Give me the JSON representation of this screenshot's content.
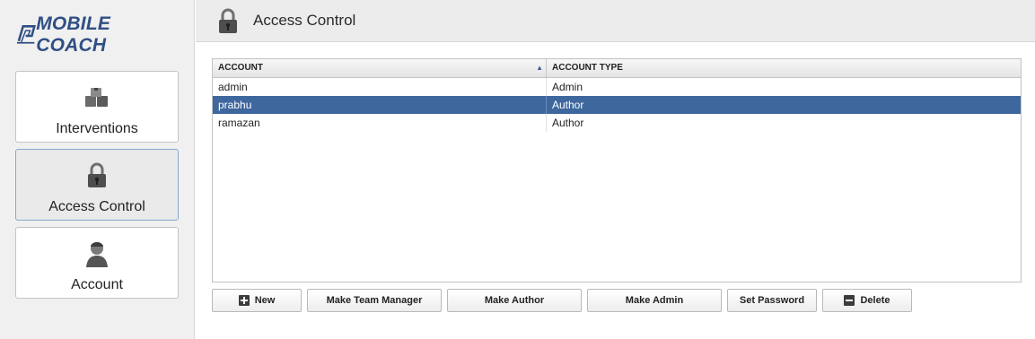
{
  "brand": {
    "logo_text": "MOBILE COACH"
  },
  "sidebar": {
    "items": [
      {
        "label": "Interventions",
        "icon": "interventions-icon"
      },
      {
        "label": "Access Control",
        "icon": "lock-icon"
      },
      {
        "label": "Account",
        "icon": "user-icon"
      }
    ],
    "active_index": 1
  },
  "header": {
    "title": "Access Control",
    "icon": "lock-icon"
  },
  "table": {
    "columns": [
      "ACCOUNT",
      "ACCOUNT TYPE"
    ],
    "sort": {
      "column": "ACCOUNT",
      "direction": "ascending",
      "indicator": "▲"
    },
    "rows": [
      {
        "account": "admin",
        "type": "Admin"
      },
      {
        "account": "prabhu",
        "type": "Author"
      },
      {
        "account": "ramazan",
        "type": "Author"
      }
    ],
    "selected_row": 1
  },
  "actions": {
    "new": "New",
    "make_team_manager": "Make Team Manager",
    "make_author": "Make Author",
    "make_admin": "Make Admin",
    "set_password": "Set Password",
    "delete": "Delete"
  },
  "colors": {
    "accent": "#3e679e",
    "logo": "#2f4f84"
  }
}
